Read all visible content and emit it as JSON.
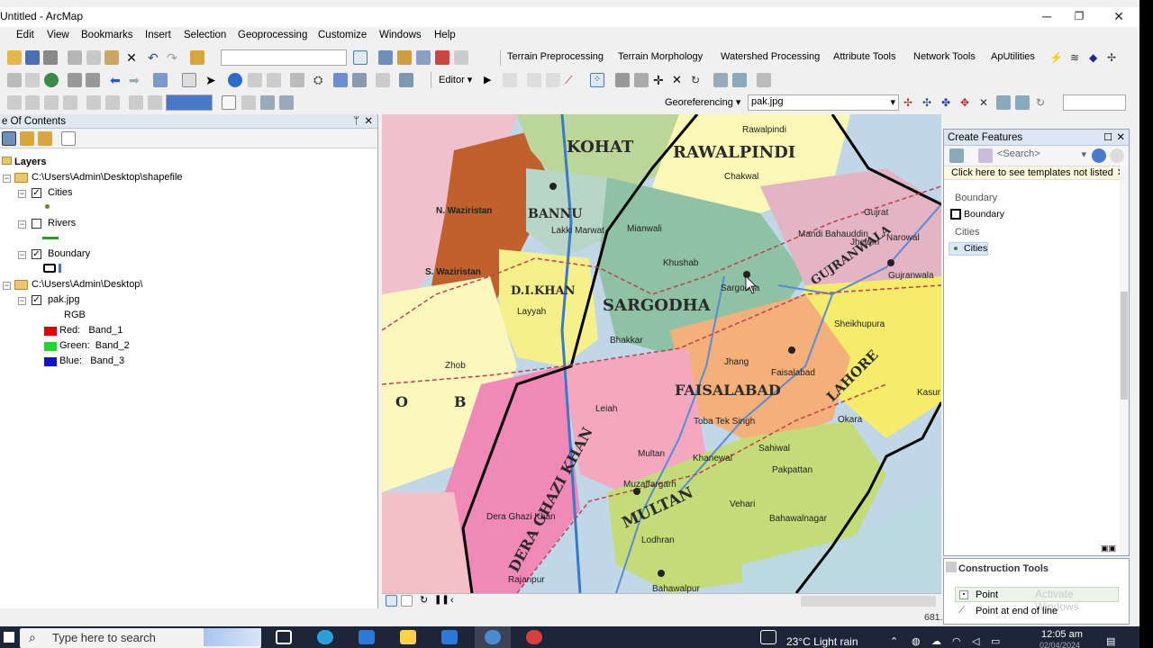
{
  "window": {
    "title": "Untitled - ArcMap"
  },
  "menu": [
    "Edit",
    "View",
    "Bookmarks",
    "Insert",
    "Selection",
    "Geoprocessing",
    "Customize",
    "Windows",
    "Help"
  ],
  "toolbars": {
    "extension_menus": [
      "Terrain Preprocessing",
      "Terrain Morphology",
      "Watershed Processing",
      "Attribute Tools",
      "Network Tools",
      "ApUtilities"
    ],
    "editor_label": "Editor",
    "georeferencing_label": "Georeferencing",
    "raster_combo_value": "pak.jpg"
  },
  "toc": {
    "title": "e Of Contents",
    "root": "Layers",
    "groups": [
      {
        "path": "C:\\Users\\Admin\\Desktop\\shapefile",
        "layers": [
          {
            "name": "Cities",
            "checked": true
          },
          {
            "name": "Rivers",
            "checked": false
          },
          {
            "name": "Boundary",
            "checked": true
          }
        ]
      },
      {
        "path": "C:\\Users\\Admin\\Desktop\\",
        "layers": [
          {
            "name": "pak.jpg",
            "checked": true,
            "sub": "RGB",
            "bands": [
              {
                "label": "Red:",
                "band": "Band_1",
                "color": "#e00000"
              },
              {
                "label": "Green:",
                "band": "Band_2",
                "color": "#27d42c"
              },
              {
                "label": "Blue:",
                "band": "Band_3",
                "color": "#1212d4"
              }
            ]
          }
        ]
      }
    ]
  },
  "map": {
    "region_labels": [
      "KOHAT",
      "RAWALPINDI",
      "BANNU",
      "D.I.KHAN",
      "SARGODHA",
      "FAISALABAD",
      "LAHORE",
      "GUJRANWALA",
      "DERA GHAZI KHAN",
      "MULTAN",
      "O",
      "B"
    ],
    "place_labels": [
      "Rawalpindi",
      "Chakwal",
      "Gujrat",
      "Sargodha",
      "Khushab",
      "Mianwali",
      "Bhakkar",
      "Jhang",
      "Faisalabad",
      "Leiah",
      "Muzaffargarh",
      "Multan",
      "Khanewal",
      "Sahiwal",
      "Pakpattan",
      "Vehari",
      "Lodhran",
      "Bahawalnagar",
      "Bahawalpur",
      "Dera Ghazi Khan",
      "Rajanpur",
      "Toba Tek Singh",
      "Okara",
      "Kasur",
      "Sheikhupura",
      "Gujranwala",
      "Mandi Bahauddin",
      "Zhob",
      "N. Waziristan",
      "S. Waziristan",
      "Lakki Marwat",
      "Layyah",
      "Jhelum",
      "Narowal"
    ]
  },
  "create_features": {
    "title": "Create Features",
    "search_placeholder": "<Search>",
    "info": "Click here to see templates not listed",
    "templates": [
      {
        "group": "Boundary",
        "item": "Boundary"
      },
      {
        "group": "Cities",
        "item": "Cities"
      }
    ]
  },
  "construction_tools": {
    "title": "Construction Tools",
    "items": [
      "Point",
      "Point at end of line"
    ],
    "watermark": "Activate Windows"
  },
  "status": {
    "coords": "681."
  },
  "taskbar": {
    "search_placeholder": "Type here to search",
    "weather": "23°C  Light rain",
    "time": "12:05 am",
    "date": "02/04/2024"
  }
}
